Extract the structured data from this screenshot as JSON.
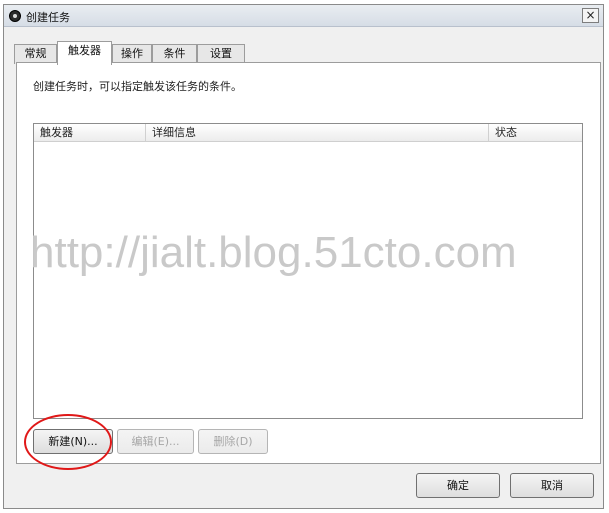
{
  "window": {
    "title": "创建任务",
    "close_symbol": "×"
  },
  "tabs": [
    {
      "label": "常规",
      "active": false
    },
    {
      "label": "触发器",
      "active": true
    },
    {
      "label": "操作",
      "active": false
    },
    {
      "label": "条件",
      "active": false
    },
    {
      "label": "设置",
      "active": false
    }
  ],
  "panel": {
    "description": "创建任务时，可以指定触发该任务的条件。",
    "columns": [
      "触发器",
      "详细信息",
      "状态"
    ],
    "rows": []
  },
  "buttons": {
    "new_label": "新建(N)...",
    "edit_label": "编辑(E)...",
    "delete_label": "删除(D)",
    "ok_label": "确定",
    "cancel_label": "取消"
  },
  "watermark": "http://jialt.blog.51cto.com",
  "colors": {
    "highlight": "#e01818",
    "window_bg": "#f0f0f0"
  }
}
